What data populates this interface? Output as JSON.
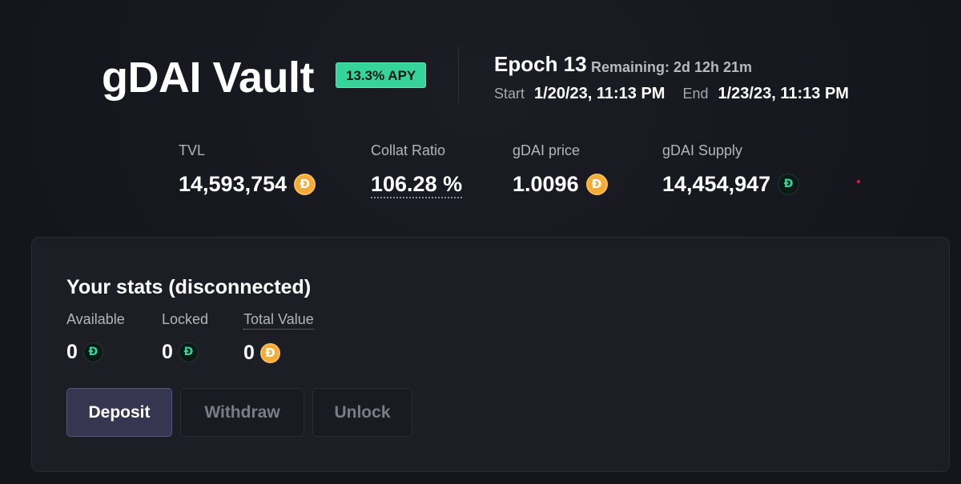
{
  "header": {
    "title": "gDAI Vault",
    "apy_badge": "13.3% APY"
  },
  "epoch": {
    "title": "Epoch 13",
    "remaining": "Remaining: 2d 12h 21m",
    "start_label": "Start",
    "start_value": "1/20/23, 11:13 PM",
    "end_label": "End",
    "end_value": "1/23/23, 11:13 PM"
  },
  "stats": {
    "tvl": {
      "label": "TVL",
      "value": "14,593,754",
      "icon": "dai-coin-icon"
    },
    "collat_ratio": {
      "label": "Collat Ratio",
      "value": "106.28 %"
    },
    "gdai_price": {
      "label": "gDAI price",
      "value": "1.0096",
      "icon": "dai-coin-icon"
    },
    "gdai_supply": {
      "label": "gDAI Supply",
      "value": "14,454,947",
      "icon": "gdai-coin-icon"
    }
  },
  "your_stats": {
    "title": "Your stats (disconnected)",
    "available": {
      "label": "Available",
      "value": "0",
      "icon": "gdai-coin-icon"
    },
    "locked": {
      "label": "Locked",
      "value": "0",
      "icon": "gdai-coin-icon"
    },
    "total_value": {
      "label": "Total Value",
      "value": "0",
      "icon": "dai-coin-icon"
    }
  },
  "actions": {
    "deposit": "Deposit",
    "withdraw": "Withdraw",
    "unlock": "Unlock"
  },
  "colors": {
    "background": "#16161d",
    "panel": "#1d1d26",
    "apy_green": "#35d49a",
    "dai_orange": "#f5ac37",
    "deposit_button": "#363650"
  }
}
